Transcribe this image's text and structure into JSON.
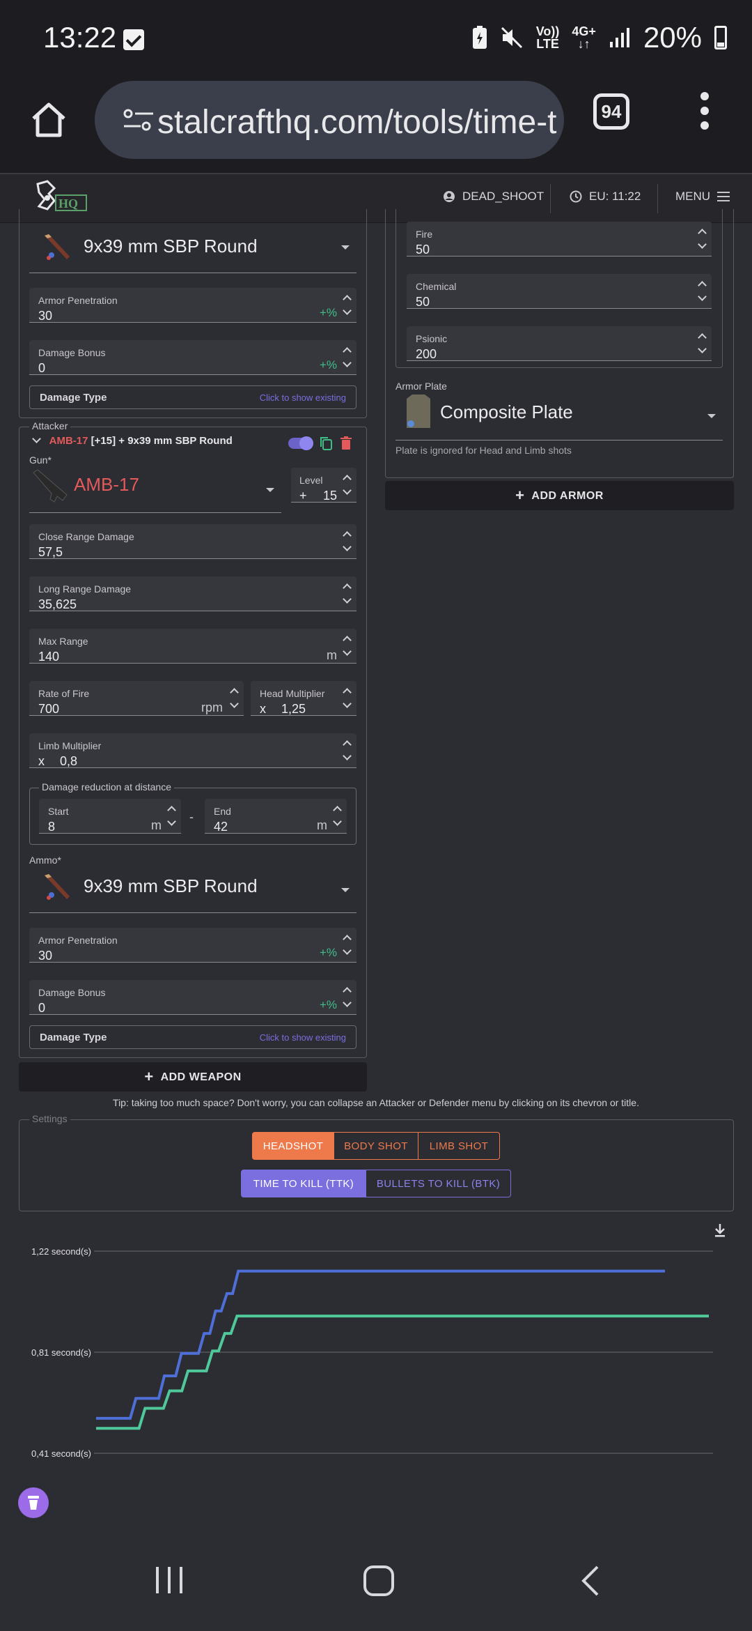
{
  "status_bar": {
    "time": "13:22",
    "net_top": "Vo))",
    "net_bottom": "LTE",
    "net2_top": "4G+",
    "net2_bottom": "↓↑",
    "battery": "20%"
  },
  "browser": {
    "url": "stalcrafthq.com/tools/time-t",
    "tab_count": "94"
  },
  "header": {
    "logo_text": "HQ",
    "user": "DEAD_SHOOT",
    "server_time": "EU: 11:22",
    "menu": "MENU"
  },
  "defender_ammo": {
    "ammo_name": "9x39 mm SBP Round",
    "armor_pen_label": "Armor Penetration",
    "armor_pen_value": "30",
    "armor_pen_suffix": "+%",
    "dmg_bonus_label": "Damage Bonus",
    "dmg_bonus_value": "0",
    "dmg_bonus_suffix": "+%",
    "dmg_type_label": "Damage Type",
    "dmg_type_hint": "Click to show existing"
  },
  "armor": {
    "fire_label": "Fire",
    "fire_value": "50",
    "chemical_label": "Chemical",
    "chemical_value": "50",
    "psionic_label": "Psionic",
    "psionic_value": "200",
    "plate_label": "Armor Plate",
    "plate_name": "Composite Plate",
    "plate_note": "Plate is ignored for Head and Limb shots",
    "add_armor": "ADD ARMOR"
  },
  "attacker": {
    "legend": "Attacker",
    "title_gun": "AMB-17",
    "title_level": "[+15]",
    "title_sep": "+",
    "title_ammo": "9x39 mm SBP Round",
    "gun_label": "Gun*",
    "gun_name": "AMB-17",
    "level_label": "Level",
    "level_prefix": "+",
    "level_value": "15",
    "close_dmg_label": "Close Range Damage",
    "close_dmg_value": "57,5",
    "long_dmg_label": "Long Range Damage",
    "long_dmg_value": "35,625",
    "max_range_label": "Max Range",
    "max_range_value": "140",
    "max_range_unit": "m",
    "rof_label": "Rate of Fire",
    "rof_value": "700",
    "rof_unit": "rpm",
    "head_mult_label": "Head Multiplier",
    "head_mult_prefix": "x",
    "head_mult_value": "1,25",
    "limb_mult_label": "Limb Multiplier",
    "limb_mult_prefix": "x",
    "limb_mult_value": "0,8",
    "reduction_legend": "Damage reduction at distance",
    "start_label": "Start",
    "start_value": "8",
    "start_unit": "m",
    "range_sep": "-",
    "end_label": "End",
    "end_value": "42",
    "end_unit": "m",
    "ammo_label": "Ammo*",
    "ammo_name": "9x39 mm SBP Round",
    "armor_pen_label": "Armor Penetration",
    "armor_pen_value": "30",
    "armor_pen_suffix": "+%",
    "dmg_bonus_label": "Damage Bonus",
    "dmg_bonus_value": "0",
    "dmg_bonus_suffix": "+%",
    "dmg_type_label": "Damage Type",
    "dmg_type_hint": "Click to show existing",
    "toggle_on": true
  },
  "add_weapon": "ADD WEAPON",
  "tip": "Tip: taking too much space? Don't worry, you can collapse an Attacker or Defender menu by clicking on its chevron or title.",
  "settings": {
    "legend": "Settings",
    "shot_options": [
      "HEADSHOT",
      "BODY SHOT",
      "LIMB SHOT"
    ],
    "shot_selected": "HEADSHOT",
    "metric_options": [
      "TIME TO KILL (TTK)",
      "BULLETS TO KILL (BTK)"
    ],
    "metric_selected": "TIME TO KILL (TTK)"
  },
  "colors": {
    "accent_orange": "#ee7a4c",
    "accent_purple": "#7b6fe0",
    "series_blue": "#4f6fd8",
    "series_green": "#4fc99a",
    "danger_red": "#e25a5a"
  },
  "chart_data": {
    "type": "line",
    "y_ticks": [
      "1,22 second(s)",
      "0,81 second(s)",
      "0,41 second(s)"
    ],
    "ylim": [
      0.41,
      1.22
    ],
    "x_label": "",
    "y_label": "",
    "series": [
      {
        "values": [
          [
            0,
            0.55
          ],
          [
            6,
            0.55
          ],
          [
            7,
            0.63
          ],
          [
            11,
            0.63
          ],
          [
            12,
            0.72
          ],
          [
            14,
            0.72
          ],
          [
            15,
            0.81
          ],
          [
            18,
            0.81
          ],
          [
            19,
            0.89
          ],
          [
            20,
            0.89
          ],
          [
            21,
            0.98
          ],
          [
            22,
            0.98
          ],
          [
            23,
            1.05
          ],
          [
            24,
            1.05
          ],
          [
            25,
            1.14
          ],
          [
            100,
            1.14
          ]
        ]
      },
      {
        "values": [
          [
            0,
            0.51
          ],
          [
            7,
            0.51
          ],
          [
            8,
            0.59
          ],
          [
            11,
            0.59
          ],
          [
            12,
            0.66
          ],
          [
            14,
            0.66
          ],
          [
            15,
            0.74
          ],
          [
            18,
            0.74
          ],
          [
            19,
            0.82
          ],
          [
            20,
            0.82
          ],
          [
            21,
            0.89
          ],
          [
            22,
            0.89
          ],
          [
            23,
            0.96
          ],
          [
            100,
            0.96
          ]
        ]
      }
    ]
  },
  "nav": {
    "recent": "recent-apps",
    "home": "home",
    "back": "back"
  }
}
